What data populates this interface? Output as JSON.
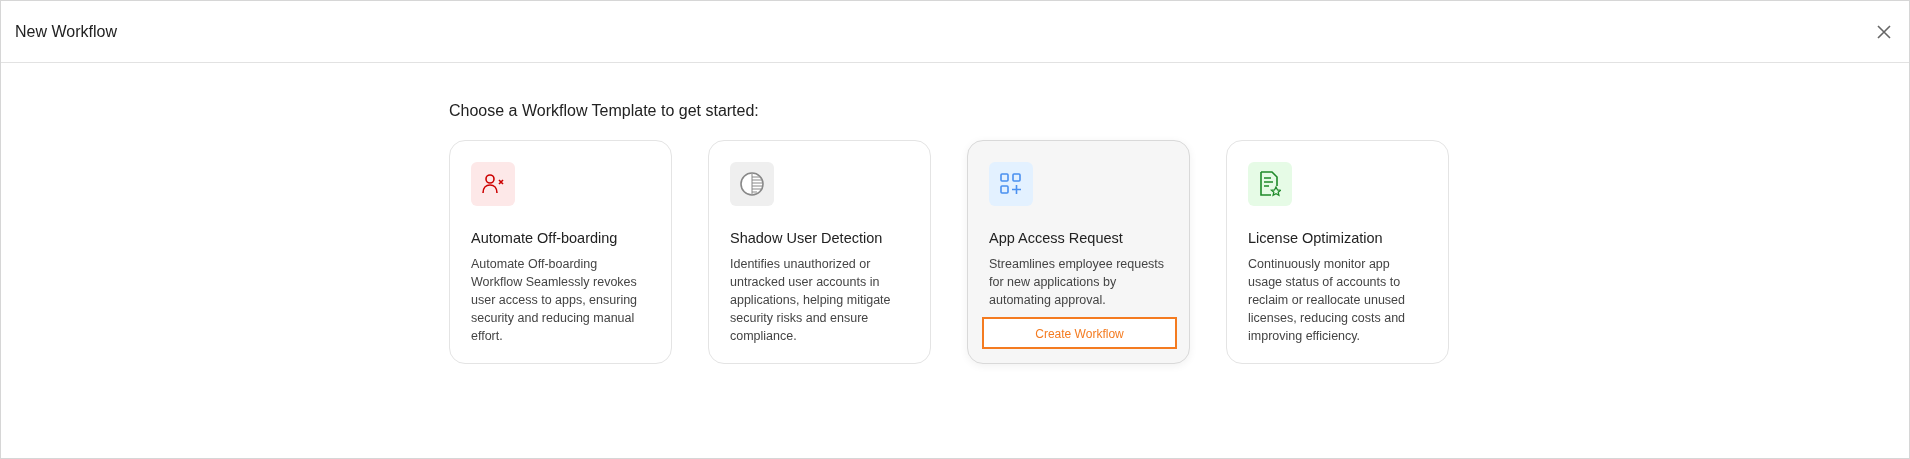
{
  "window": {
    "title": "New Workflow"
  },
  "heading": "Choose a Workflow Template to get started:",
  "templates": [
    {
      "kind": "offboarding",
      "title": "Automate Off-boarding",
      "description": "Automate Off-boarding Workflow Seamlessly revokes user access to apps, ensuring security and reducing manual effort."
    },
    {
      "kind": "shadow",
      "title": "Shadow User Detection",
      "description": "Identifies unauthorized or untracked user accounts in applications, helping mitigate security risks and ensure compliance."
    },
    {
      "kind": "access",
      "title": "App Access Request",
      "description": "Streamlines employee requests for new applications by automating approval.",
      "hovered": true,
      "button": "Create Workflow"
    },
    {
      "kind": "license",
      "title": "License Optimization",
      "description": "Continuously monitor app usage status of accounts to reclaim or reallocate unused licenses, reducing costs and improving efficiency."
    }
  ]
}
